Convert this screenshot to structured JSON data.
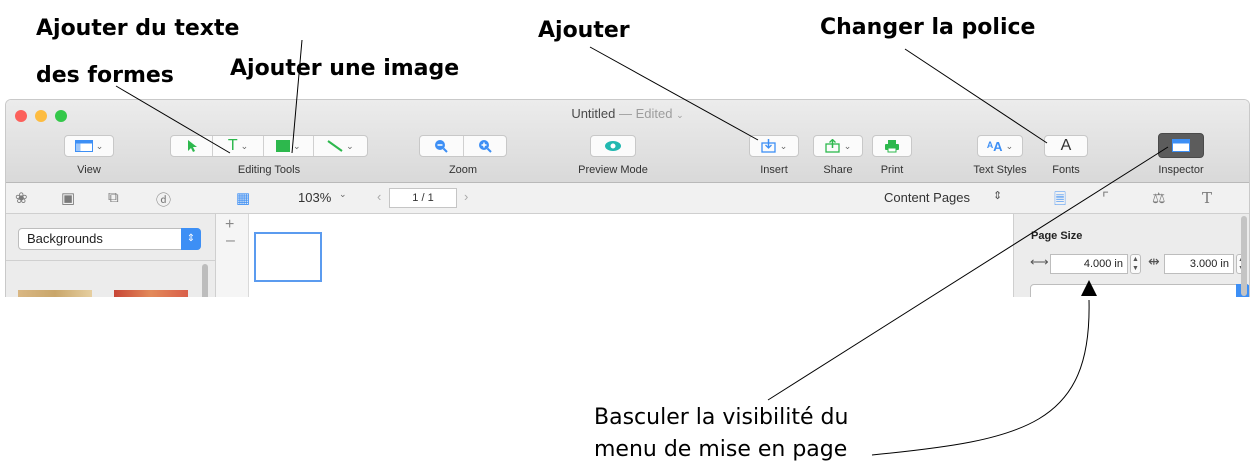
{
  "callouts": {
    "add_text": "Ajouter du texte",
    "add_shapes": "des formes",
    "add_image": "Ajouter une image",
    "add": "Ajouter",
    "change_font": "Changer la police",
    "toggle_line1": "Basculer la visibilité du",
    "toggle_line2": "menu de mise en page"
  },
  "window": {
    "title": "Untitled",
    "title_suffix": "— Edited",
    "toolbar": {
      "view": "View",
      "editing_tools": "Editing Tools",
      "zoom": "Zoom",
      "preview_mode": "Preview Mode",
      "insert": "Insert",
      "share": "Share",
      "print": "Print",
      "text_styles": "Text Styles",
      "fonts": "Fonts",
      "inspector": "Inspector"
    },
    "secondbar": {
      "zoom_level": "103%",
      "page_indicator": "1 / 1",
      "content_pages": "Content Pages"
    },
    "left_panel": {
      "select_value": "Backgrounds"
    },
    "inspector": {
      "page_size_label": "Page Size",
      "width": "4.000 in",
      "height": "3.000 in"
    }
  },
  "colors": {
    "selection_blue": "#3d8ff5",
    "shape_green": "#2db84d",
    "close": "#fc605b",
    "minimize": "#fdbc40",
    "zoom": "#34c84a"
  }
}
